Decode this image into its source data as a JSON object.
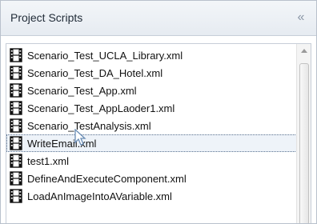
{
  "panel": {
    "title": "Project Scripts",
    "collapse_icon": "double-chevron-left-icon",
    "collapse_glyph": "«"
  },
  "scripts": {
    "selected_index": 5,
    "items": [
      {
        "label": "Scenario_Test_UCLA_Library.xml"
      },
      {
        "label": "Scenario_Test_DA_Hotel.xml"
      },
      {
        "label": "Scenario_Test_App.xml"
      },
      {
        "label": "Scenario_Test_AppLaoder1.xml"
      },
      {
        "label": "Scenario_TestAnalysis.xml"
      },
      {
        "label": "WriteEmail.xml"
      },
      {
        "label": "test1.xml"
      },
      {
        "label": "DefineAndExecuteComponent.xml"
      },
      {
        "label": "LoadAnImageIntoAVariable.xml"
      }
    ],
    "item_icon": "film-strip-file-icon"
  },
  "colors": {
    "accent": "#5a7290",
    "selected_bg": "#eef3f9"
  }
}
